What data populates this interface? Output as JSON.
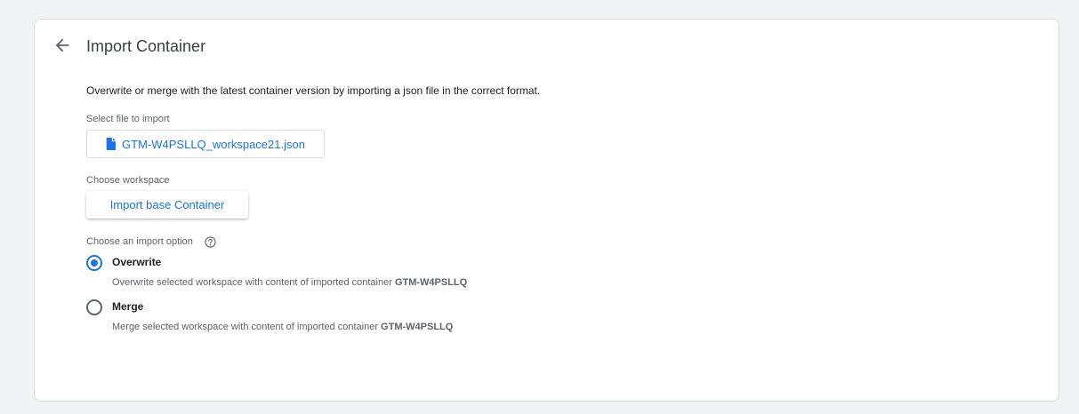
{
  "header": {
    "title": "Import Container",
    "back_icon": "arrow-left-icon"
  },
  "description": "Overwrite or merge with the latest container version by importing a json file in the correct format.",
  "file_section": {
    "label": "Select file to import",
    "file_name": "GTM-W4PSLLQ_workspace21.json",
    "file_icon": "file-icon"
  },
  "workspace_section": {
    "label": "Choose workspace",
    "button_label": "Import base Container"
  },
  "import_option": {
    "label": "Choose an import option",
    "help_icon": "help-circle-icon",
    "options": [
      {
        "label": "Overwrite",
        "description": "Overwrite selected workspace with content of imported container ",
        "container_id": "GTM-W4PSLLQ",
        "selected": true
      },
      {
        "label": "Merge",
        "description": "Merge selected workspace with content of imported container ",
        "container_id": "GTM-W4PSLLQ",
        "selected": false
      }
    ]
  },
  "colors": {
    "accent": "#1a73e8",
    "background": "#f1f3f4",
    "card": "#ffffff",
    "border": "#dadce0",
    "text_secondary": "#5f6368"
  }
}
